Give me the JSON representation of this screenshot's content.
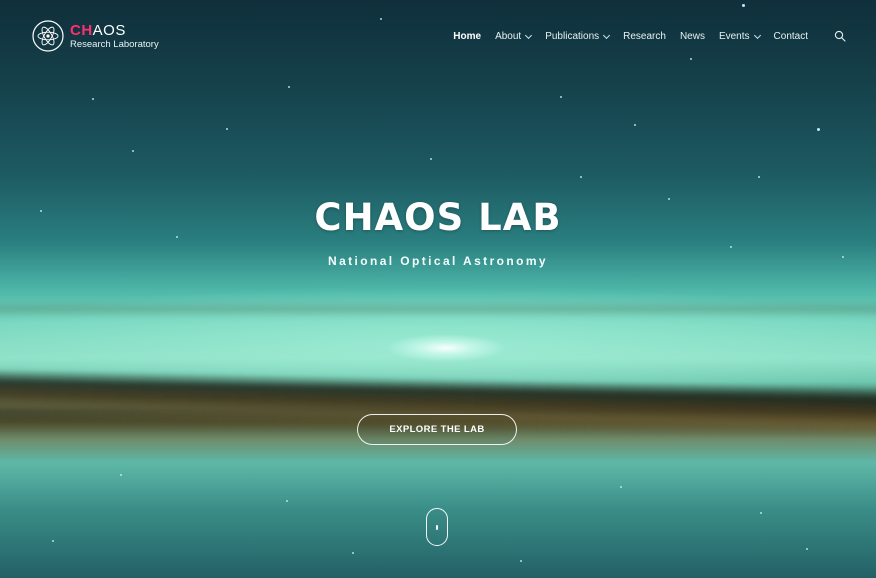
{
  "brand": {
    "logo_accent": "CH",
    "logo_rest": "AOS",
    "tagline": "Research Laboratory",
    "accent_color": "#ff2f6e"
  },
  "nav": {
    "items": [
      {
        "label": "Home",
        "active": true,
        "has_dropdown": false
      },
      {
        "label": "About",
        "active": false,
        "has_dropdown": true
      },
      {
        "label": "Publications",
        "active": false,
        "has_dropdown": true
      },
      {
        "label": "Research",
        "active": false,
        "has_dropdown": false
      },
      {
        "label": "News",
        "active": false,
        "has_dropdown": false
      },
      {
        "label": "Events",
        "active": false,
        "has_dropdown": true
      },
      {
        "label": "Contact",
        "active": false,
        "has_dropdown": false
      }
    ],
    "search_icon": "search-icon"
  },
  "hero": {
    "title": "CHAOS LAB",
    "subtitle": "National Optical Astronomy",
    "cta_label": "EXPLORE THE LAB",
    "scroll_icon": "mouse-scroll-icon"
  }
}
